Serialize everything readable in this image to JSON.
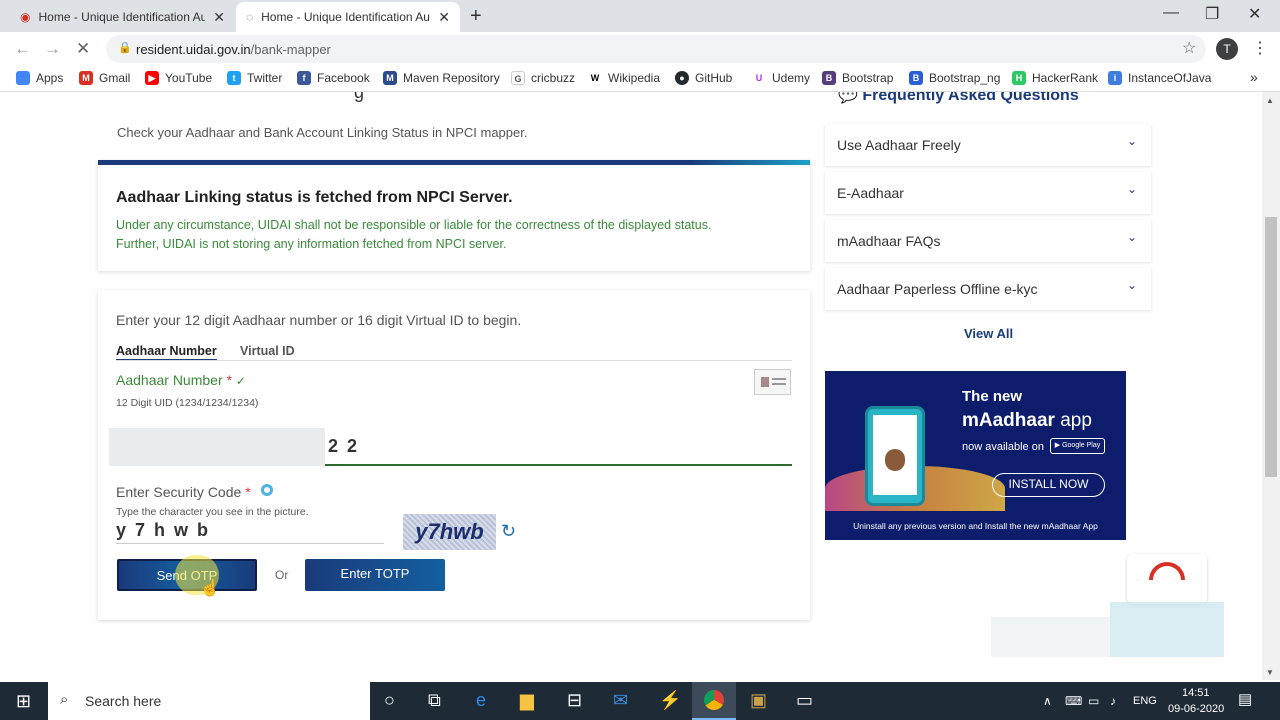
{
  "browser": {
    "tabs": [
      {
        "title": "Home - Unique Identification Au"
      },
      {
        "title": "Home - Unique Identification Au"
      }
    ],
    "new_tab": "+",
    "close_glyph": "✕",
    "url_domain": "resident.uidai.gov.in",
    "url_path": "/bank-mapper",
    "profile_initial": "T",
    "bookmarks": [
      {
        "label": "Apps",
        "color": "#4285f4"
      },
      {
        "label": "Gmail",
        "color": "#d93025"
      },
      {
        "label": "YouTube",
        "color": "#ff0000"
      },
      {
        "label": "Twitter",
        "color": "#1da1f2"
      },
      {
        "label": "Facebook",
        "color": "#3b5998"
      },
      {
        "label": "Maven Repository",
        "color": "#2b4b8c"
      },
      {
        "label": "cricbuzz",
        "color": "#555555"
      },
      {
        "label": "Wikipedia",
        "color": "#000000"
      },
      {
        "label": "GitHub",
        "color": "#24292e"
      },
      {
        "label": "Udemy",
        "color": "#a435f0"
      },
      {
        "label": "Bootstrap",
        "color": "#563d7c"
      },
      {
        "label": "Bootstrap_ng",
        "color": "#2a5fd6"
      },
      {
        "label": "HackerRank",
        "color": "#2ec866"
      },
      {
        "label": "InstanceOfJava",
        "color": "#3d7ddc"
      }
    ],
    "more_bookmarks": "»"
  },
  "main": {
    "heading_partial": "g",
    "intro": "Check your Aadhaar and Bank Account Linking Status in NPCI mapper.",
    "notice_title": "Aadhaar Linking status is fetched from NPCI Server.",
    "notice_body_1": "Under any circumstance, UIDAI shall not be responsible or liable for the correctness of the displayed status.",
    "notice_body_2": "Further, UIDAI is not storing any information fetched from NPCI server.",
    "form_prompt": "Enter your 12 digit Aadhaar number or 16 digit Virtual ID to begin.",
    "tabs": [
      "Aadhaar Number",
      "Virtual ID"
    ],
    "aadhaar_label": "Aadhaar Number",
    "required_mark": "*",
    "aadhaar_hint": "12 Digit UID (1234/1234/1234)",
    "aadhaar_value_visible": "2 2",
    "security_label": "Enter Security Code",
    "security_hint": "Type the character you see in the picture.",
    "security_value": "y 7 h w b",
    "captcha_text": "y7hwb",
    "send_otp": "Send OTP",
    "or": "Or",
    "enter_totp": "Enter TOTP"
  },
  "sidebar": {
    "faq_heading": "Frequently Asked Questions",
    "faqs": [
      "Use Aadhaar Freely",
      "E-Aadhaar",
      "mAadhaar FAQs",
      "Aadhaar Paperless Offline e-kyc"
    ],
    "view_all": "View All",
    "promo_line1": "The new",
    "promo_line2_bold": "mAadhaar",
    "promo_line2_rest": " app",
    "promo_line3": "now available on",
    "promo_store": "Google Play",
    "promo_install": "INSTALL NOW",
    "promo_footer": "Uninstall any previous version and Install the new mAadhaar App"
  },
  "taskbar": {
    "search_placeholder": "Search here",
    "lang": "ENG",
    "time": "14:51",
    "date": "09-06-2020"
  },
  "colors": {
    "accent_blue": "#1a3a7a",
    "notice_green": "#3a8a3a",
    "input_underline": "#2e6b2e",
    "promo_bg": "#0d1d6b"
  }
}
